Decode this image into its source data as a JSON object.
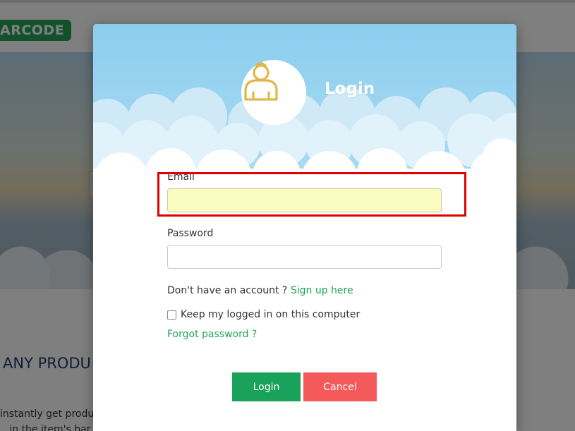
{
  "background": {
    "logo_text": "ARCODE",
    "heading": "ANY PRODU",
    "text_line_1": "instantly get produc",
    "text_line_2": "...in the item's bar..."
  },
  "modal": {
    "title": "Login",
    "avatar_icon": "user-icon",
    "email_label": "Email",
    "email_value": "",
    "password_label": "Password",
    "password_value": "",
    "account_prompt": "Don't have an account ?",
    "signup_link": "Sign up here",
    "remember_label": "Keep my logged in on this computer",
    "remember_checked": false,
    "forgot_link": "Forgot password ?",
    "login_button": "Login",
    "cancel_button": "Cancel"
  },
  "colors": {
    "accent_green": "#1aa25a",
    "cancel_red": "#f55a5a",
    "sky_blue": "#90cfee",
    "autofill_yellow": "#fafcc0",
    "highlight_red": "#e00000",
    "avatar_gold": "#e2b64e"
  }
}
